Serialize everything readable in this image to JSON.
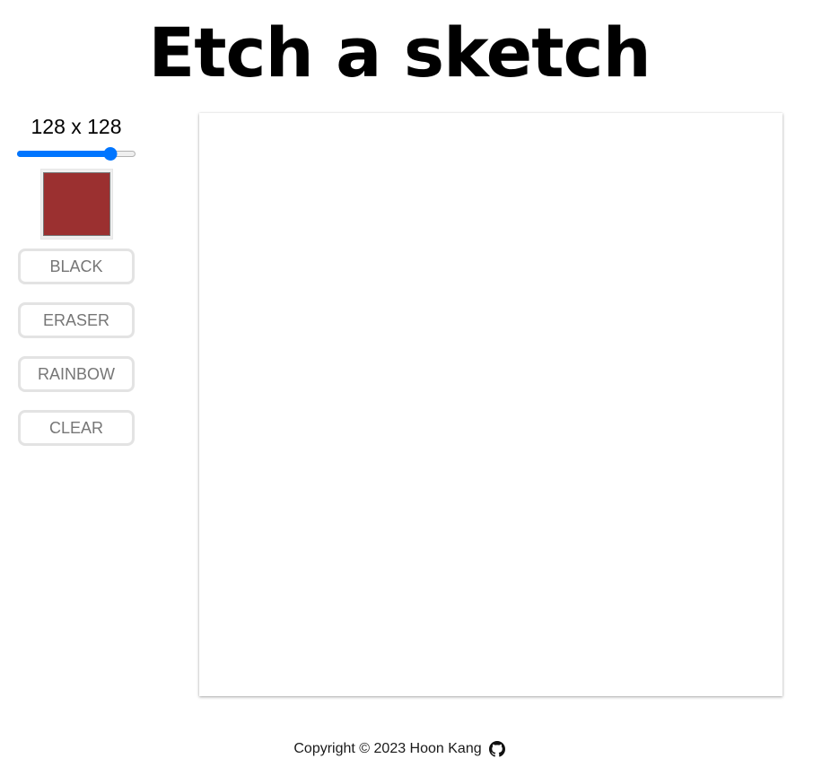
{
  "title": "Etch a sketch",
  "grid": {
    "size_label": "128 x 128",
    "slider_fraction": 0.82
  },
  "color_picker": {
    "value": "#9b3030"
  },
  "buttons": {
    "black": "BLACK",
    "eraser": "ERASER",
    "rainbow": "RAINBOW",
    "clear": "CLEAR"
  },
  "footer": {
    "copyright": "Copyright © 2023 Hoon Kang",
    "icon": "github-icon"
  },
  "colors": {
    "accent": "#0075ff",
    "button_text": "#767676",
    "button_border": "#e3e3e3"
  }
}
